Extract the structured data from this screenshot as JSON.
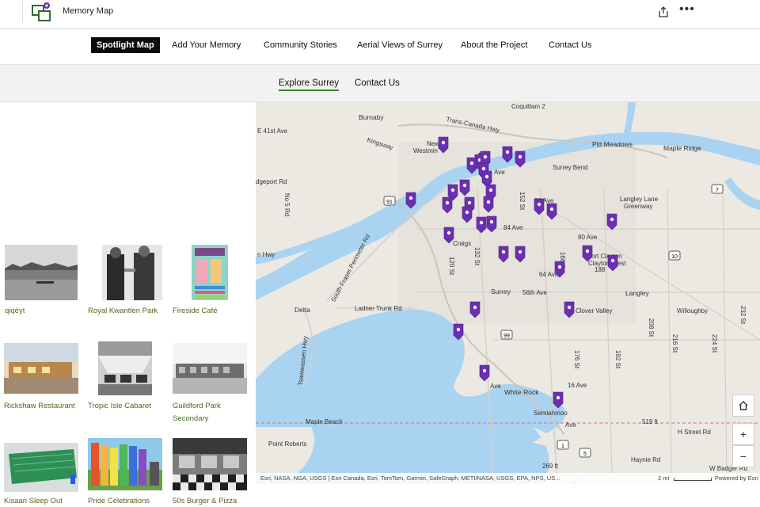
{
  "app": {
    "title": "Memory Map"
  },
  "nav": {
    "items": [
      {
        "label": "Spotlight Map",
        "active": true
      },
      {
        "label": "Add Your Memory",
        "active": false
      },
      {
        "label": "Community Stories",
        "active": false
      },
      {
        "label": "Aerial Views of Surrey",
        "active": false
      },
      {
        "label": "About the Project",
        "active": false
      },
      {
        "label": "Contact Us",
        "active": false
      }
    ]
  },
  "subnav": {
    "items": [
      {
        "label": "Explore Surrey",
        "active": true
      },
      {
        "label": "Contact Us",
        "active": false
      }
    ]
  },
  "gallery": {
    "items": [
      {
        "caption": "qiqéyt"
      },
      {
        "caption": "Royal Kwantlen Park"
      },
      {
        "caption": "Fireside Café"
      },
      {
        "caption": "Rickshaw Restaurant"
      },
      {
        "caption": "Tropic Isle Cabaret"
      },
      {
        "caption": "Guildford Park"
      },
      {
        "caption": "Secondary"
      },
      {
        "caption": "Kisaan Sleep Out"
      },
      {
        "caption": "Pride Celebrations"
      },
      {
        "caption": "50s Burger & Pizza"
      }
    ]
  },
  "map": {
    "labels": [
      "Coquitlam 2",
      "Burnaby",
      "E 41st Ave",
      "Trans-Canada Hwy",
      "Kingsway",
      "New",
      "Westmin",
      "Pitt Meadows",
      "Maple Ridge",
      "Surrey Bend",
      "dgeport Rd",
      "No 5 Rd",
      "96 Ave",
      "Langley Lane",
      "Greenway",
      "84 Ave",
      "80 Ave",
      "Fort Clayton",
      "Clayton West",
      "188",
      "n Hwy",
      "Craigs",
      "64 Ave",
      "Surrey",
      "56th Ave",
      "Langley",
      "Delta",
      "Ladner Trunk Rd",
      "South Fraser Perimeter Rd",
      "Clover Valley",
      "Willoughby",
      "Tsawwassen Hwy",
      "White Rock",
      "16 Ave",
      "Semiahmoo",
      "Maple Beach",
      "H Street Rd",
      "Point Roberts",
      "Haynie Rd",
      "W Badger Rd",
      "269 ft",
      "519 ft",
      "152 St",
      "120 St",
      "132 St",
      "168 St",
      "176 St",
      "192 St",
      "208 St",
      "216 St",
      "224 St",
      "232 St",
      "Ave",
      "Ave",
      "Ave"
    ],
    "road_shields": [
      "91",
      "99",
      "5",
      "7",
      "10",
      "1"
    ],
    "attribution": "Esri, NASA, NGA, USGS | Esri Canada, Esri, TomTom, Garmin, SafeGraph, METI/NASA, USGS, EPA, NPS, US...",
    "scale": "2 mi",
    "powered": "Powered by Esri",
    "accent_pin": "#6b2fb3",
    "water": "#a9d3f1"
  }
}
